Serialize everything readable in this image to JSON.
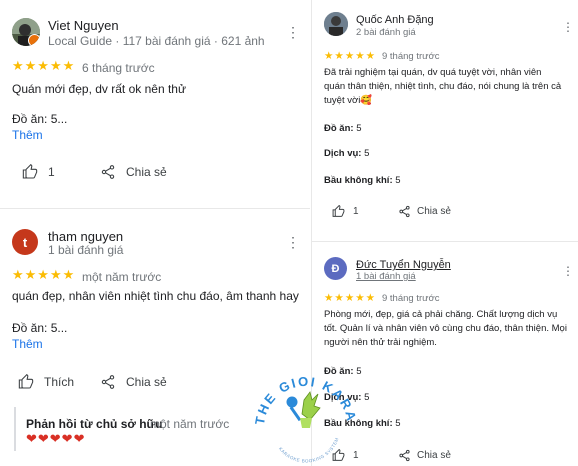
{
  "left_reviews": [
    {
      "name": "Viet Nguyen",
      "meta": "Local Guide · 117 bài đánh giá · 621 ảnh",
      "stars": "★★★★★",
      "time": "6 tháng trước",
      "text": "Quán mới đẹp, dv rất ok nên thử",
      "food": "Đồ ăn: 5...",
      "more": "Thêm",
      "like_label": "1",
      "share_label": "Chia sẻ"
    },
    {
      "name": "tham nguyen",
      "avatar_letter": "t",
      "meta": "1 bài đánh giá",
      "stars": "★★★★★",
      "time": "một năm trước",
      "text": "quán đẹp, nhân viên nhiệt tình chu đáo, âm thanh hay",
      "food": "Đồ ăn: 5...",
      "more": "Thêm",
      "like_label": "Thích",
      "share_label": "Chia sẻ",
      "owner_reply_title": "Phản hồi từ chủ sở hữu",
      "owner_reply_time": "một năm trước",
      "owner_reply_hearts": "❤❤❤❤❤"
    }
  ],
  "right_reviews": [
    {
      "name": "Quốc Anh Đặng",
      "meta": "2 bài đánh giá",
      "stars": "★★★★★",
      "time": "9 tháng trước",
      "text": "Đã trải nghiệm tại quán, dv quá tuyệt vời, nhân viên quán thân thiện, nhiệt tình, chu đáo, nói chung là trên cả tuyệt vời🥰",
      "food_label": "Đồ ăn:",
      "food_value": "5",
      "service_label": "Dịch vụ:",
      "service_value": "5",
      "ambience_label": "Bầu không khí:",
      "ambience_value": "5",
      "like_label": "1",
      "share_label": "Chia sẻ"
    },
    {
      "name": "Đức Tuyển Nguyễn",
      "avatar_letter": "Đ",
      "meta": "1 bài đánh giá",
      "stars": "★★★★★",
      "time": "9 tháng trước",
      "text": "Phòng mới, đẹp, giá cả phải chăng. Chất lượng dịch vụ tốt. Quản lí và nhân viên vô cùng chu đáo, thân thiện. Mọi người nên thử trải nghiệm.",
      "food_label": "Đồ ăn:",
      "food_value": "5",
      "service_label": "Dịch vụ:",
      "service_value": "5",
      "ambience_label": "Bầu không khí:",
      "ambience_value": "5",
      "like_label": "1",
      "share_label": "Chia sẻ"
    }
  ],
  "watermark": {
    "text": "THE GIOI KARAOKE",
    "subtext": "KARAOKE BOOKING SYSTEM"
  },
  "colors": {
    "star": "#fbbc04",
    "link": "#1a73e8",
    "avatar_t": "#c5381b",
    "avatar_d": "#5c6bc0"
  }
}
